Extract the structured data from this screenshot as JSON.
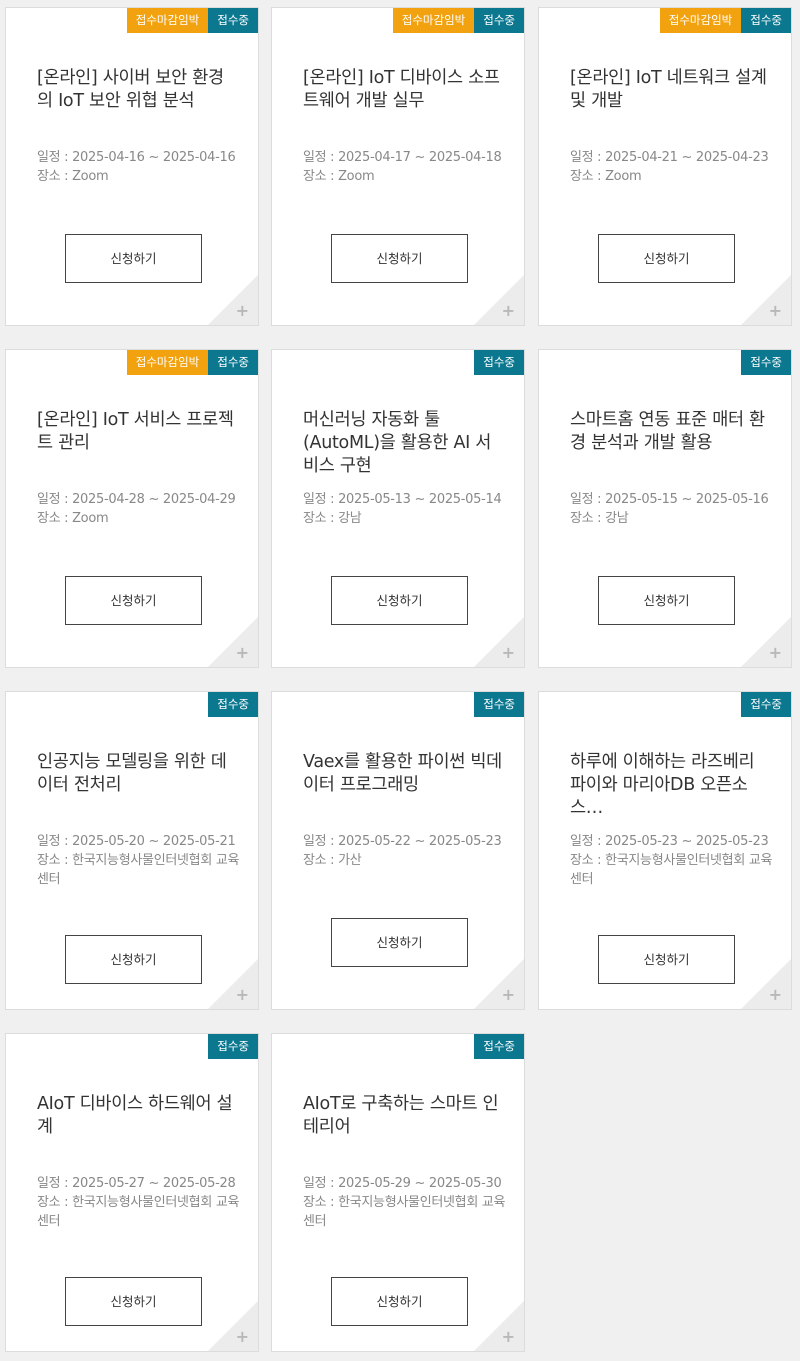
{
  "labels": {
    "date_prefix": "일정 : ",
    "place_prefix": "장소 : ",
    "apply": "신청하기",
    "plus": "+"
  },
  "cards": [
    {
      "badges": [
        "접수마감임박",
        "접수중"
      ],
      "title": "[온라인] 사이버 보안 환경의 IoT 보안 위협 분석",
      "date": "2025-04-16 ~ 2025-04-16",
      "place": "Zoom"
    },
    {
      "badges": [
        "접수마감임박",
        "접수중"
      ],
      "title": "[온라인] IoT 디바이스 소프트웨어 개발 실무",
      "date": "2025-04-17 ~ 2025-04-18",
      "place": "Zoom"
    },
    {
      "badges": [
        "접수마감임박",
        "접수중"
      ],
      "title": "[온라인] IoT 네트워크 설계 및 개발",
      "date": "2025-04-21 ~ 2025-04-23",
      "place": "Zoom"
    },
    {
      "badges": [
        "접수마감임박",
        "접수중"
      ],
      "title": "[온라인] IoT 서비스 프로젝트 관리",
      "date": "2025-04-28 ~ 2025-04-29",
      "place": "Zoom"
    },
    {
      "badges": [
        "접수중"
      ],
      "title": "머신러닝 자동화 툴(AutoML)을 활용한 AI 서비스 구현",
      "date": "2025-05-13 ~ 2025-05-14",
      "place": "강남"
    },
    {
      "badges": [
        "접수중"
      ],
      "title": "스마트홈 연동 표준 매터 환경 분석과 개발 활용",
      "date": "2025-05-15 ~ 2025-05-16",
      "place": "강남"
    },
    {
      "badges": [
        "접수중"
      ],
      "title": "인공지능 모델링을 위한 데이터 전처리",
      "date": "2025-05-20 ~ 2025-05-21",
      "place": "한국지능형사물인터넷협회 교육센터"
    },
    {
      "badges": [
        "접수중"
      ],
      "title": "Vaex를 활용한 파이썬 빅데이터 프로그래밍",
      "date": "2025-05-22 ~ 2025-05-23",
      "place": "가산"
    },
    {
      "badges": [
        "접수중"
      ],
      "title": "하루에 이해하는 라즈베리파이와 마리아DB 오픈소스…",
      "date": "2025-05-23 ~ 2025-05-23",
      "place": "한국지능형사물인터넷협회 교육센터"
    },
    {
      "badges": [
        "접수중"
      ],
      "title": "AIoT 디바이스 하드웨어 설계",
      "date": "2025-05-27 ~ 2025-05-28",
      "place": "한국지능형사물인터넷협회 교육센터"
    },
    {
      "badges": [
        "접수중"
      ],
      "title": "AIoT로 구축하는 스마트 인테리어",
      "date": "2025-05-29 ~ 2025-05-30",
      "place": "한국지능형사물인터넷협회 교육센터"
    }
  ]
}
